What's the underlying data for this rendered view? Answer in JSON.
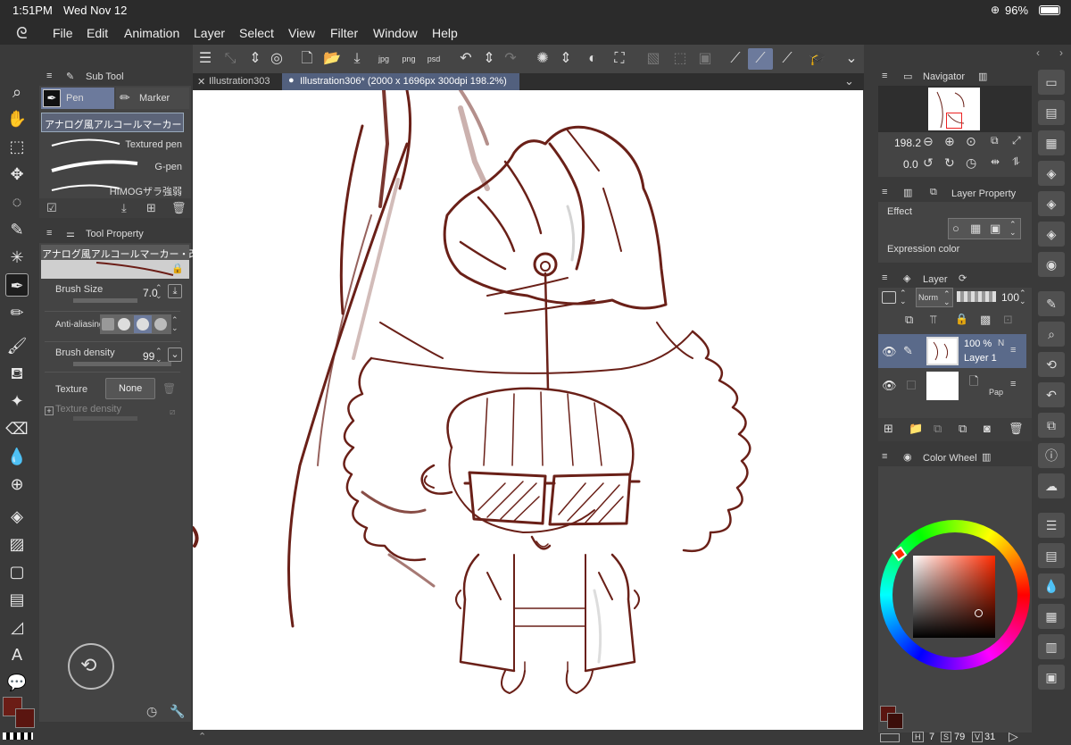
{
  "status": {
    "time": "1:51PM",
    "date": "Wed Nov 12",
    "battery": "96%"
  },
  "menu": [
    "File",
    "Edit",
    "Animation",
    "Layer",
    "Select",
    "View",
    "Filter",
    "Window",
    "Help"
  ],
  "subtool": {
    "title": "Sub Tool",
    "tabs": [
      "Pen",
      "Marker"
    ],
    "brushes": [
      "アナログ風アルコールマーカー",
      "Textured pen",
      "G-pen",
      "HIMOGザラ強弱"
    ]
  },
  "tool_property": {
    "title": "Tool Property",
    "preset_name": "アナログ風アルコールマーカー・改",
    "brush_size_label": "Brush Size",
    "brush_size": "7.0",
    "anti_aliasing_label": "Anti-aliasing",
    "brush_density_label": "Brush density",
    "brush_density": "99",
    "texture_label": "Texture",
    "texture_value": "None",
    "texture_density_label": "Texture density"
  },
  "doc_tabs": [
    "Illustration303",
    "Illustration306* (2000 x 1696px 300dpi 198.2%)"
  ],
  "navigator": {
    "title": "Navigator",
    "zoom": "198.2",
    "rotation": "0.0"
  },
  "layer_property": {
    "title": "Layer Property",
    "effect_label": "Effect",
    "expression_color_label": "Expression color"
  },
  "layer_panel": {
    "title": "Layer",
    "blend_mode": "Norm",
    "opacity": "100",
    "layers": [
      {
        "opacity": "100 %",
        "mode": "N",
        "name": "Layer 1"
      },
      {
        "name": "Pape"
      }
    ]
  },
  "color_wheel": {
    "title": "Color Wheel"
  },
  "colors": {
    "main": "#6b1d16",
    "sub": "#5a1510",
    "line": "#6a2018",
    "accent": "#6c7a9c"
  },
  "color_values": {
    "h_label": "H",
    "h": "7",
    "s_label": "S",
    "s": "79",
    "v_label": "V",
    "v": "31"
  }
}
